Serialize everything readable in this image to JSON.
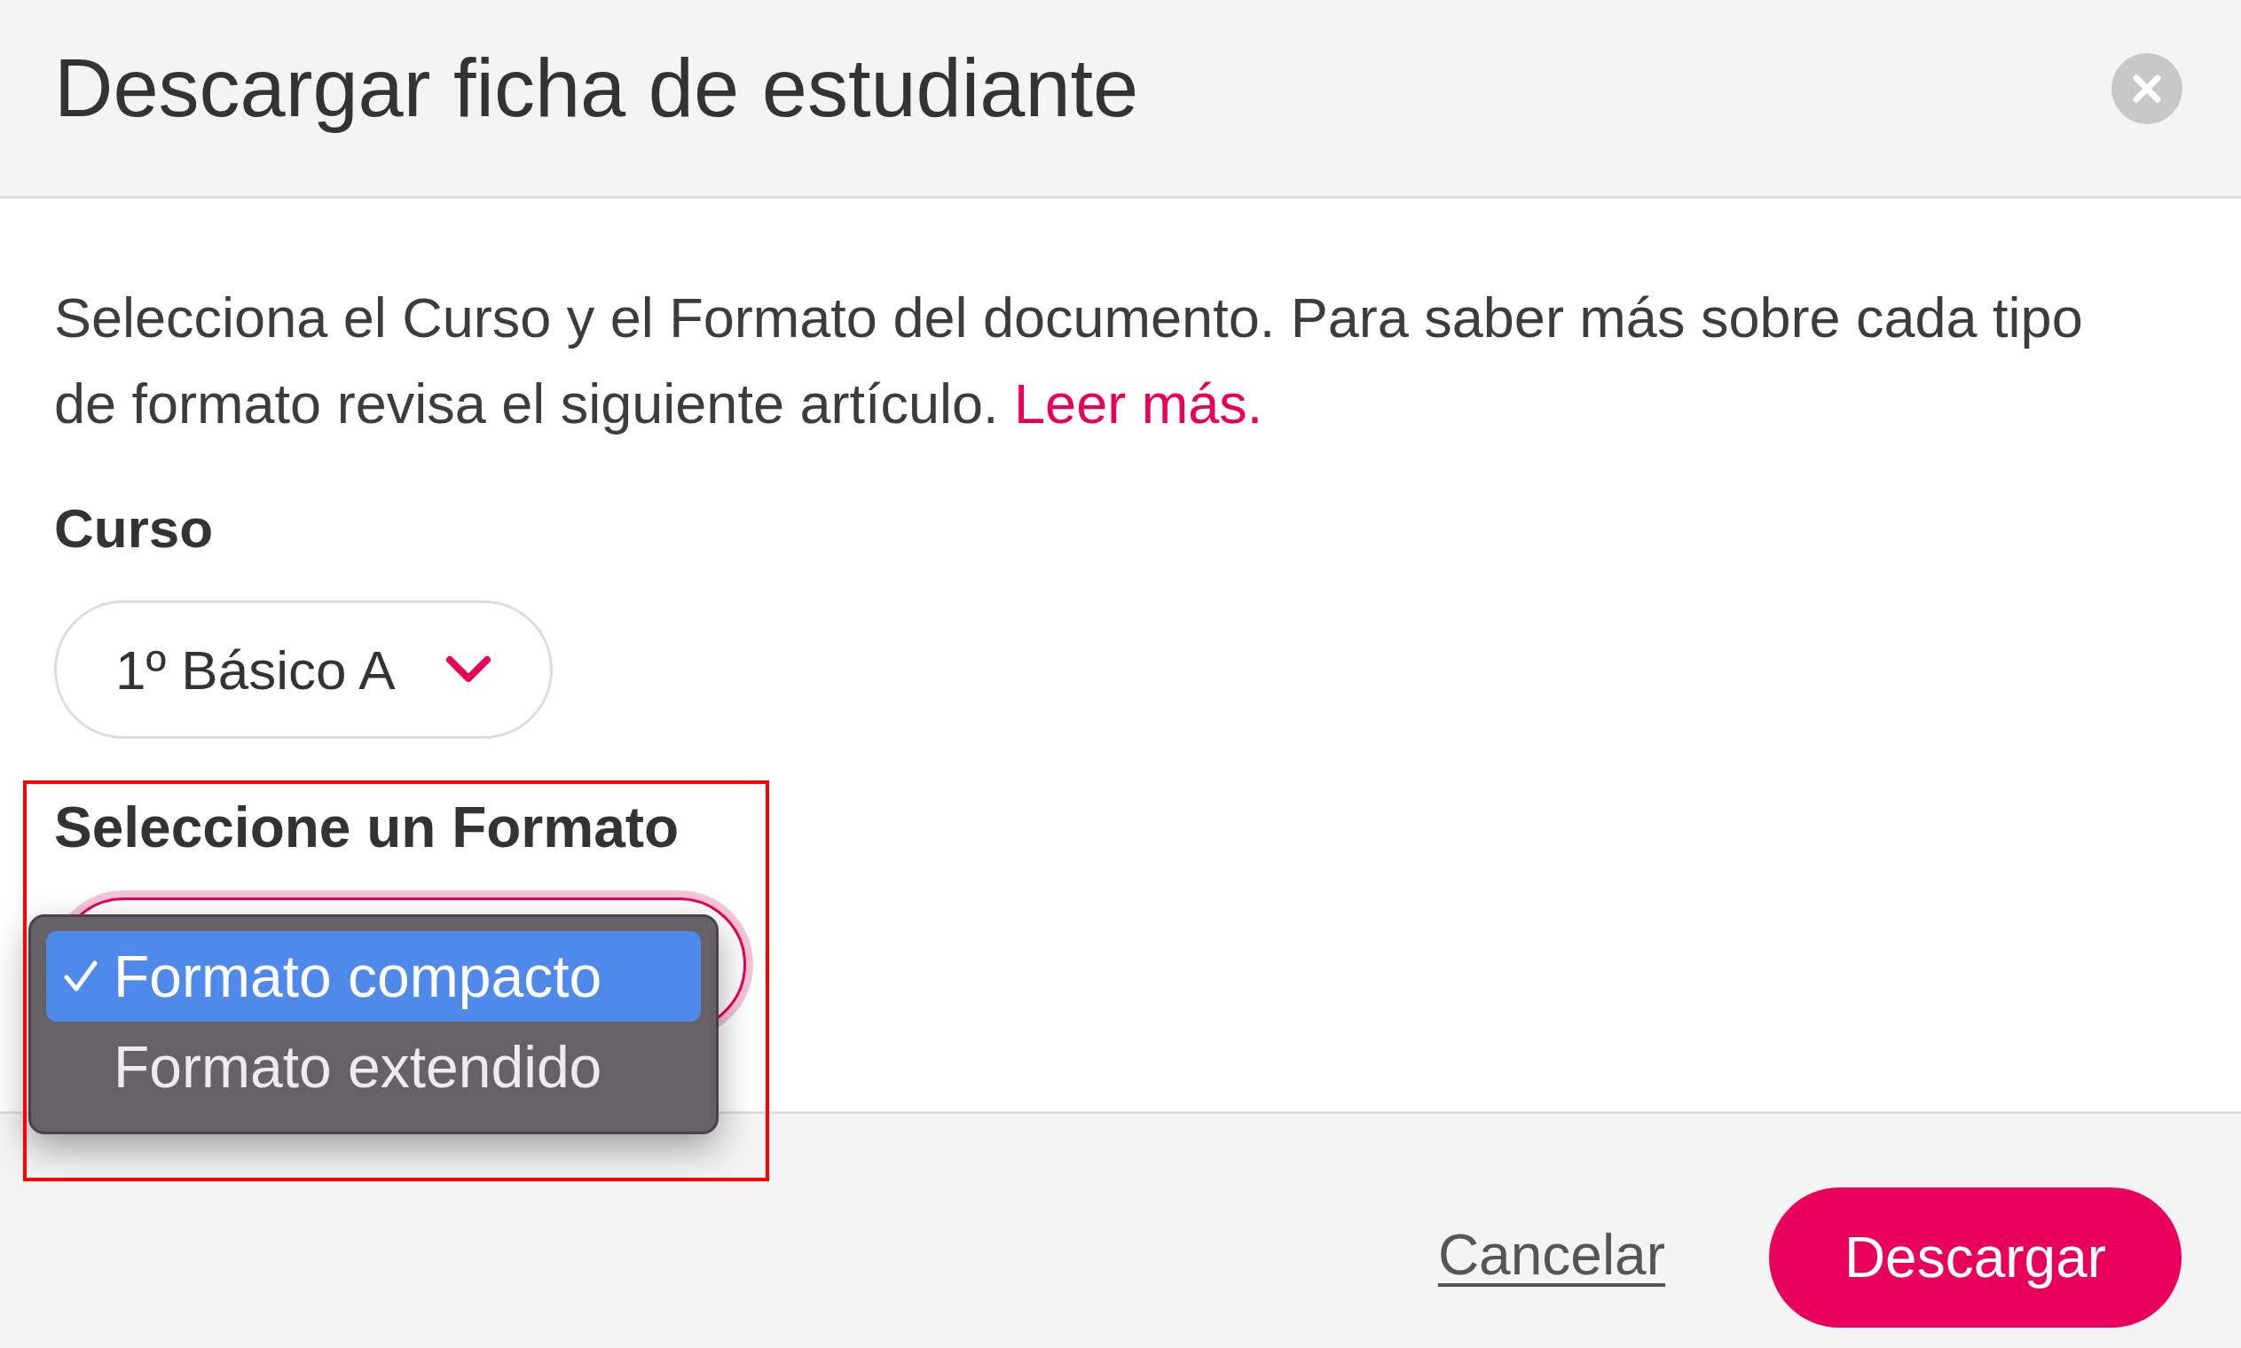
{
  "dialog": {
    "title": "Descargar ficha de estudiante"
  },
  "description": {
    "text": "Selecciona el Curso y el Formato del documento. Para saber más sobre cada tipo de formato revisa el siguiente artículo.",
    "link": "Leer más."
  },
  "course_field": {
    "label": "Curso",
    "value": "1º Básico A"
  },
  "format_field": {
    "label": "Seleccione un Formato",
    "highlighted": true,
    "focused": true,
    "open": true,
    "options": [
      {
        "label": "Formato compacto",
        "selected": true
      },
      {
        "label": "Formato extendido",
        "selected": false
      }
    ]
  },
  "footer": {
    "buttons": [
      {
        "label": "Cancelar",
        "kind": "link"
      },
      {
        "label": "Descargar",
        "kind": "primary"
      }
    ]
  }
}
